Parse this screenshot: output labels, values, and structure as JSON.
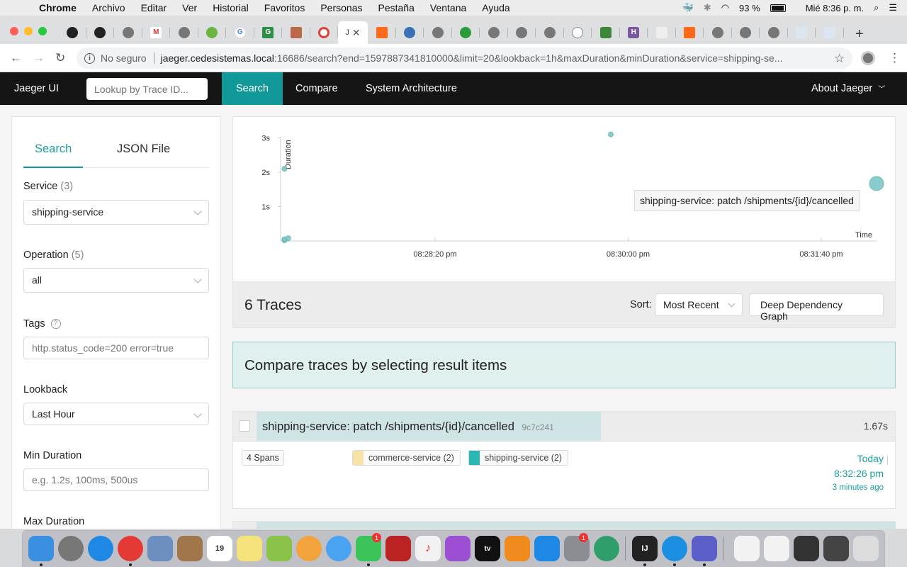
{
  "menubar": {
    "app": "Chrome",
    "items": [
      "Archivo",
      "Editar",
      "Ver",
      "Historial",
      "Favoritos",
      "Personas",
      "Pestaña",
      "Ventana",
      "Ayuda"
    ],
    "battery": "93 %",
    "clock": "Mié 8:36 p. m."
  },
  "browser": {
    "active_tab_title": "J",
    "url_insecure_label": "No seguro",
    "url_host": "jaeger.cedesistemas.local",
    "url_rest": ":16686/search?end=1597887341810000&limit=20&lookback=1h&maxDuration&minDuration&service=shipping-se...",
    "colors": {
      "tabstrip": "#dedfe1",
      "toolbar": "#ffffff"
    }
  },
  "nav": {
    "brand": "Jaeger UI",
    "lookup_placeholder": "Lookup by Trace ID...",
    "tabs": [
      "Search",
      "Compare",
      "System Architecture"
    ],
    "about": "About Jaeger",
    "colors": {
      "bar": "#151515",
      "active": "#119999"
    }
  },
  "sidebar": {
    "tabs": [
      "Search",
      "JSON File"
    ],
    "service_label": "Service",
    "service_count": "(3)",
    "service_value": "shipping-service",
    "operation_label": "Operation",
    "operation_count": "(5)",
    "operation_value": "all",
    "tags_label": "Tags",
    "tags_help": "?",
    "tags_placeholder": "http.status_code=200 error=true",
    "lookback_label": "Lookback",
    "lookback_value": "Last Hour",
    "min_duration_label": "Min Duration",
    "min_duration_placeholder": "e.g. 1.2s, 100ms, 500us",
    "max_duration_label": "Max Duration"
  },
  "chart_data": {
    "type": "scatter",
    "ylabel": "Duration",
    "xlabel": "Time",
    "yticks": [
      "1s",
      "2s",
      "3s"
    ],
    "xticks": [
      "08:28:20 pm",
      "08:30:00 pm",
      "08:31:40 pm"
    ],
    "tooltip": "shipping-service: patch /shipments/{id}/cancelled",
    "points": [
      {
        "x": "08:27:02 pm",
        "y_s": 2.1,
        "span_count": 1
      },
      {
        "x": "08:27:02 pm",
        "y_s": 0.02,
        "span_count": 1
      },
      {
        "x": "08:27:02 pm",
        "y_s": 0.05,
        "span_count": 1
      },
      {
        "x": "08:27:04 pm",
        "y_s": 0.08,
        "span_count": 1
      },
      {
        "x": "08:29:51 pm",
        "y_s": 3.1,
        "span_count": 1
      },
      {
        "x": "08:32:26 pm",
        "y_s": 1.67,
        "span_count": 4
      }
    ],
    "point_color": "#7fc6c6"
  },
  "results": {
    "count_label": "6 Traces",
    "sort_label": "Sort:",
    "sort_value": "Most Recent",
    "ddg_button": "Deep Dependency Graph",
    "compare_hint": "Compare traces by selecting result items"
  },
  "traces": [
    {
      "title": "shipping-service: patch /shipments/{id}/cancelled",
      "trace_id": "9c7c241",
      "duration": "1.67s",
      "spans": "4 Spans",
      "services": [
        {
          "name": "commerce-service (2)",
          "color": "#f7e2a8"
        },
        {
          "name": "shipping-service (2)",
          "color": "#2bb7b3"
        }
      ],
      "day": "Today",
      "time": "8:32:26 pm",
      "ago": "3 minutes ago"
    }
  ]
}
